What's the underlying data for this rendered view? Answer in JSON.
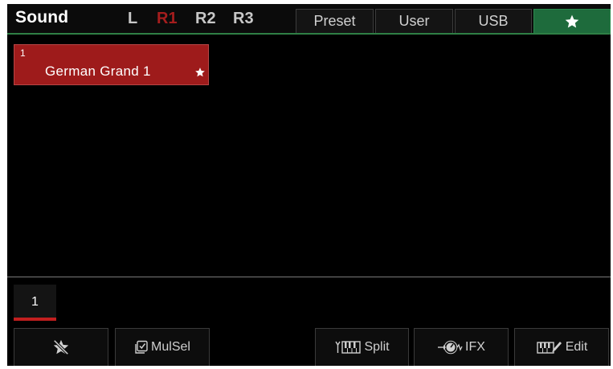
{
  "header": {
    "title": "Sound",
    "parts": [
      {
        "label": "L",
        "active": false
      },
      {
        "label": "R1",
        "active": true
      },
      {
        "label": "R2",
        "active": false
      },
      {
        "label": "R3",
        "active": false
      }
    ],
    "tabs": [
      {
        "label": "Preset",
        "active": false
      },
      {
        "label": "User",
        "active": false
      },
      {
        "label": "USB",
        "active": false
      },
      {
        "label": "",
        "icon": "star-icon",
        "active": true
      }
    ]
  },
  "sound_list": {
    "items": [
      {
        "number": "1",
        "name": "German Grand 1",
        "favorite": true,
        "selected": true
      }
    ]
  },
  "pager": {
    "pages": [
      "1"
    ],
    "current": "1"
  },
  "footer": {
    "buttons": [
      {
        "label": "",
        "icon": "unfavorite-star-icon"
      },
      {
        "label": "MulSel",
        "icon": "multi-select-icon"
      },
      {
        "label": "Split",
        "icon": "keyboard-split-icon"
      },
      {
        "label": "IFX",
        "icon": "effect-knob-icon"
      },
      {
        "label": "Edit",
        "icon": "keyboard-edit-icon"
      }
    ]
  },
  "colors": {
    "accent_red": "#9e1b1b",
    "accent_green": "#1e6b3c",
    "background": "#000000"
  }
}
